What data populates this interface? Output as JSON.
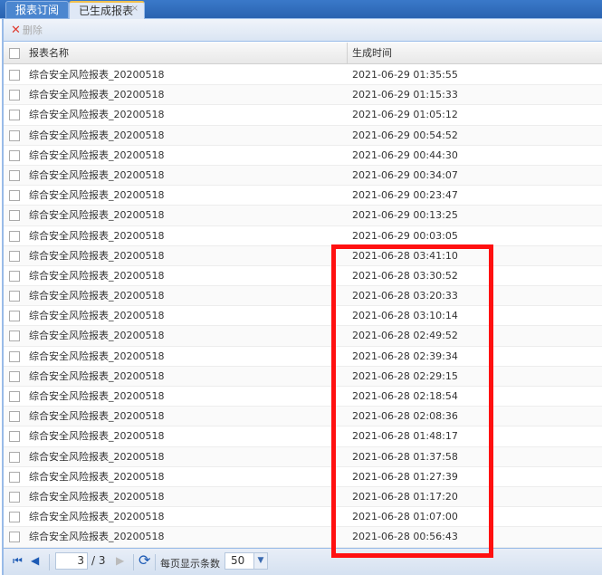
{
  "tabs": [
    {
      "label": "报表订阅"
    },
    {
      "label": "已生成报表",
      "close": "×"
    }
  ],
  "toolbar": {
    "delete_icon": "✕",
    "delete_label": "删除"
  },
  "table": {
    "headers": [
      "报表名称",
      "生成时间"
    ],
    "rows": [
      [
        "综合安全风险报表_20200518",
        "2021-06-29 01:35:55"
      ],
      [
        "综合安全风险报表_20200518",
        "2021-06-29 01:15:33"
      ],
      [
        "综合安全风险报表_20200518",
        "2021-06-29 01:05:12"
      ],
      [
        "综合安全风险报表_20200518",
        "2021-06-29 00:54:52"
      ],
      [
        "综合安全风险报表_20200518",
        "2021-06-29 00:44:30"
      ],
      [
        "综合安全风险报表_20200518",
        "2021-06-29 00:34:07"
      ],
      [
        "综合安全风险报表_20200518",
        "2021-06-29 00:23:47"
      ],
      [
        "综合安全风险报表_20200518",
        "2021-06-29 00:13:25"
      ],
      [
        "综合安全风险报表_20200518",
        "2021-06-29 00:03:05"
      ],
      [
        "综合安全风险报表_20200518",
        "2021-06-28 03:41:10"
      ],
      [
        "综合安全风险报表_20200518",
        "2021-06-28 03:30:52"
      ],
      [
        "综合安全风险报表_20200518",
        "2021-06-28 03:20:33"
      ],
      [
        "综合安全风险报表_20200518",
        "2021-06-28 03:10:14"
      ],
      [
        "综合安全风险报表_20200518",
        "2021-06-28 02:49:52"
      ],
      [
        "综合安全风险报表_20200518",
        "2021-06-28 02:39:34"
      ],
      [
        "综合安全风险报表_20200518",
        "2021-06-28 02:29:15"
      ],
      [
        "综合安全风险报表_20200518",
        "2021-06-28 02:18:54"
      ],
      [
        "综合安全风险报表_20200518",
        "2021-06-28 02:08:36"
      ],
      [
        "综合安全风险报表_20200518",
        "2021-06-28 01:48:17"
      ],
      [
        "综合安全风险报表_20200518",
        "2021-06-28 01:37:58"
      ],
      [
        "综合安全风险报表_20200518",
        "2021-06-28 01:27:39"
      ],
      [
        "综合安全风险报表_20200518",
        "2021-06-28 01:17:20"
      ],
      [
        "综合安全风险报表_20200518",
        "2021-06-28 01:07:00"
      ],
      [
        "综合安全风险报表_20200518",
        "2021-06-28 00:56:43"
      ]
    ]
  },
  "pager": {
    "first": "⏮",
    "prev": "◀",
    "page": "3",
    "total": "/ 3",
    "next": "▶",
    "refresh": "⟳",
    "per_page_label": "每页显示条数",
    "per_page": "50",
    "dropdown": "▼"
  },
  "colors": {
    "highlight": "#ff1010",
    "accent": "#99bbe8"
  }
}
